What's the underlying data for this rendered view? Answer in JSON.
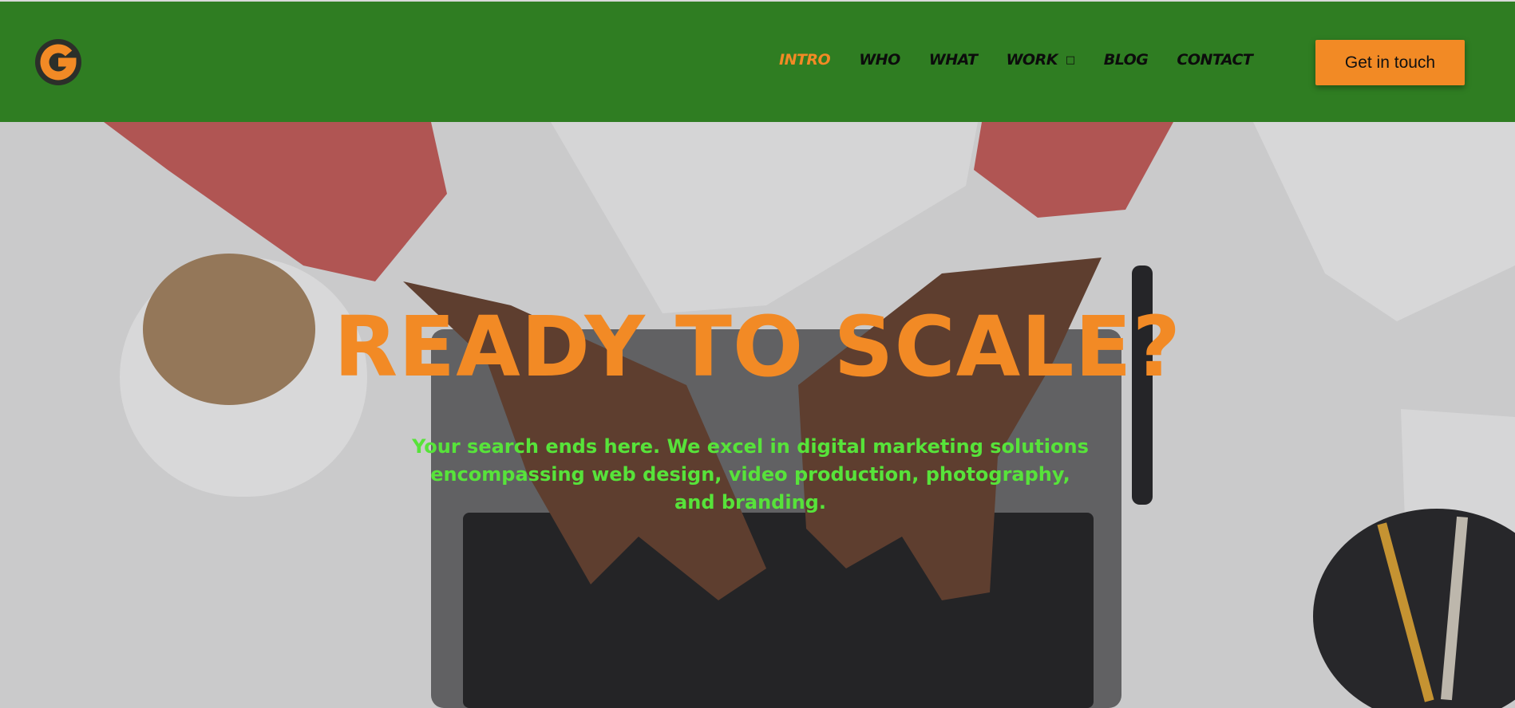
{
  "header": {
    "logo_icon": "g-logo-icon",
    "nav": [
      {
        "label": "INTRO",
        "active": true
      },
      {
        "label": "WHO",
        "active": false
      },
      {
        "label": "WHAT",
        "active": false
      },
      {
        "label": "WORK",
        "active": false,
        "has_dropdown": true
      },
      {
        "label": "BLOG",
        "active": false
      },
      {
        "label": "CONTACT",
        "active": false
      }
    ],
    "cta_label": "Get in touch"
  },
  "hero": {
    "headline": "READY TO SCALE?",
    "subheadline": "Your search ends here. We excel in digital marketing solutions encompassing web design, video production, photography, and branding."
  },
  "colors": {
    "header_bg": "#2f7d22",
    "accent": "#f28a25",
    "sub_text": "#57e33a"
  }
}
